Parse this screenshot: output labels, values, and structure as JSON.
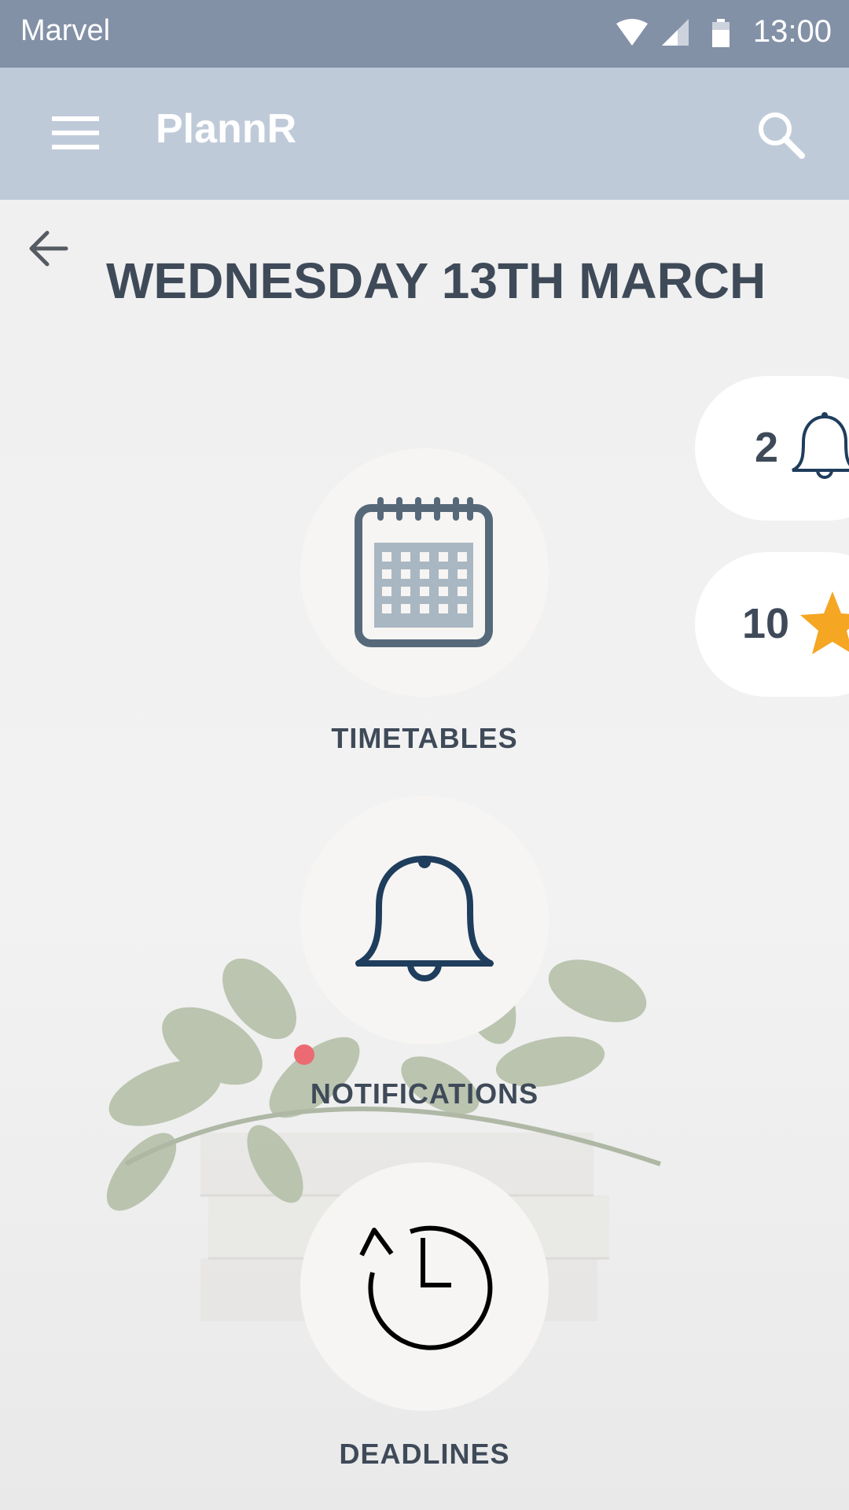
{
  "status_bar": {
    "carrier": "Marvel",
    "time": "13:00",
    "icons": [
      "wifi-icon",
      "signal-icon",
      "battery-icon"
    ]
  },
  "app_bar": {
    "title": "PlannR",
    "menu_icon": "menu-icon",
    "search_icon": "search-icon"
  },
  "page": {
    "back_icon": "arrow-back-icon",
    "title": "WEDNESDAY 13TH MARCH"
  },
  "tiles": [
    {
      "label": "TIMETABLES",
      "icon": "calendar-icon"
    },
    {
      "label": "NOTIFICATIONS",
      "icon": "bell-icon",
      "has_indicator": true
    },
    {
      "label": "DEADLINES",
      "icon": "clock-history-icon"
    }
  ],
  "badges": {
    "notifications": {
      "count": "2",
      "icon": "bell-icon"
    },
    "stars": {
      "count": "10",
      "icon": "star-icon"
    }
  },
  "colors": {
    "status_bar": "#8391a7",
    "app_bar": "#bfcad9",
    "text_dark": "#3f4a59",
    "bell_navy": "#1f3d5c",
    "calendar_slate": "#56697a",
    "star_orange": "#f5a623",
    "indicator_red": "#ec6b73"
  }
}
